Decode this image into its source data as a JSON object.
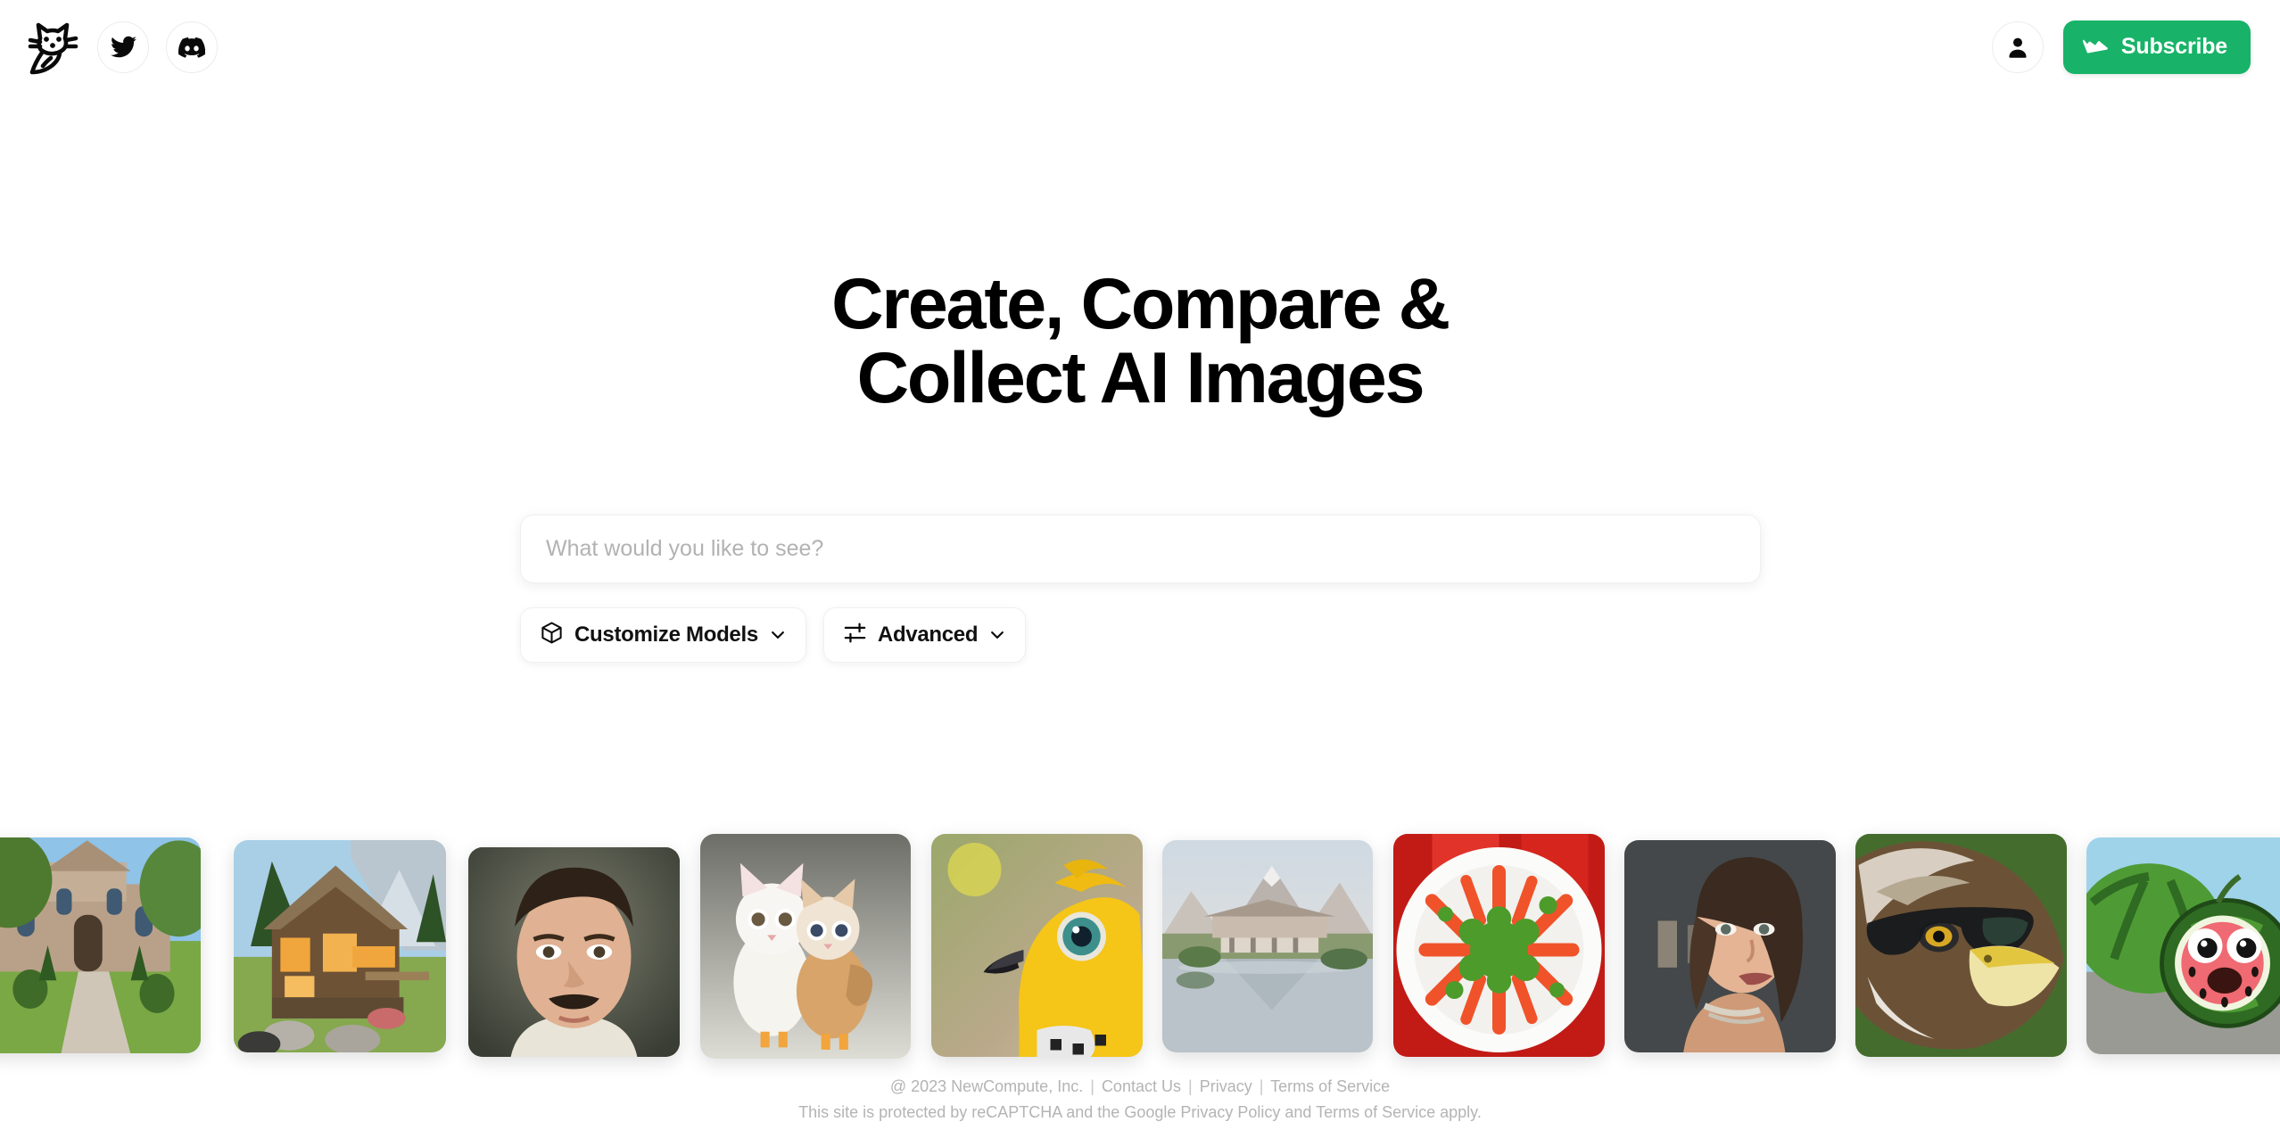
{
  "header": {
    "brand": {
      "icon": "cat-logo-icon",
      "name": "NewCompute Cat Logo"
    },
    "social": [
      {
        "icon": "twitter-icon",
        "label": "Twitter"
      },
      {
        "icon": "discord-icon",
        "label": "Discord"
      }
    ],
    "account": {
      "icon": "user-avatar-icon",
      "label": "Account"
    },
    "subscribe": {
      "icon": "crown-icon",
      "label": "Subscribe",
      "color": "#18b368"
    }
  },
  "hero": {
    "title_line1": "Create, Compare &",
    "title_line2": "Collect AI Images"
  },
  "search": {
    "placeholder": "What would you like to see?",
    "value": ""
  },
  "options": [
    {
      "icon": "cube-icon",
      "label": "Customize Models",
      "chevron": "chevron-down-icon"
    },
    {
      "icon": "sliders-icon",
      "label": "Advanced",
      "chevron": "chevron-down-icon"
    }
  ],
  "gallery": {
    "items": [
      {
        "alt": "Victorian stone mansion with garden pathway"
      },
      {
        "alt": "Wooden mountain lodge cabin with lit windows"
      },
      {
        "alt": "Portrait of a man with a mustache"
      },
      {
        "alt": "Two kitten-chicken hybrid creatures"
      },
      {
        "alt": "Yellow bird with teal eye close-up"
      },
      {
        "alt": "Modern lakeside villa with mountains"
      },
      {
        "alt": "White plate of baby carrots with parsley"
      },
      {
        "alt": "Portrait of a woman with wet hair and choker"
      },
      {
        "alt": "Eagle wearing black sunglasses"
      },
      {
        "alt": "Watermelon with a cartoon smiling face"
      }
    ]
  },
  "footer": {
    "copyright": "@ 2023 NewCompute, Inc.",
    "links": [
      "Contact Us",
      "Privacy",
      "Terms of Service"
    ],
    "separator": "|",
    "recaptcha_notice": "This site is protected by reCAPTCHA and the Google Privacy Policy and Terms of Service apply."
  }
}
